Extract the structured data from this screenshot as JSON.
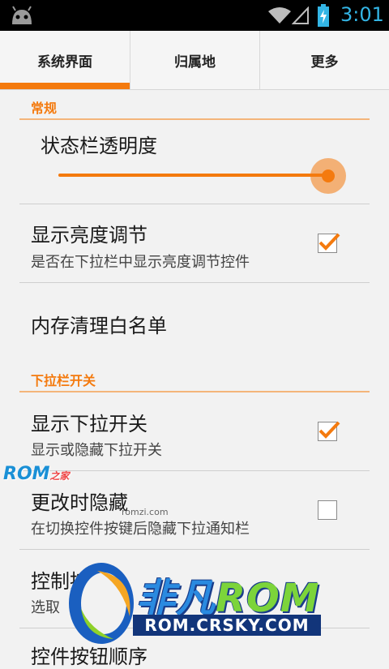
{
  "status_bar": {
    "time": "3:01"
  },
  "tabs": [
    {
      "label": "系统界面",
      "selected": true
    },
    {
      "label": "归属地",
      "selected": false
    },
    {
      "label": "更多",
      "selected": false
    }
  ],
  "sections": [
    {
      "header": "常规",
      "prefs": [
        {
          "title": "状态栏透明度",
          "type": "slider",
          "value": 1.0
        },
        {
          "title": "显示亮度调节",
          "summary": "是否在下拉栏中显示亮度调节控件",
          "checked": true
        },
        {
          "title": "内存清理白名单"
        }
      ]
    },
    {
      "header": "下拉栏开关",
      "prefs": [
        {
          "title": "显示下拉开关",
          "summary": "显示或隐藏下拉开关",
          "checked": true
        },
        {
          "title": "更改时隐藏",
          "summary": "在切换控件按键后隐藏下拉通知栏",
          "checked": false
        },
        {
          "title": "控制按",
          "summary": "选取"
        },
        {
          "title": "控件按钮顺序"
        }
      ]
    }
  ],
  "watermarks": {
    "rom_zhijia": "ROM",
    "rom_zhijia_cn": "之家",
    "small": "romzi.com",
    "logo_cn": "非凡",
    "logo_rom": "ROM",
    "logo_url": "ROM.CRSKY.COM"
  },
  "colors": {
    "accent": "#f47a0e",
    "clock": "#33b5e5"
  }
}
